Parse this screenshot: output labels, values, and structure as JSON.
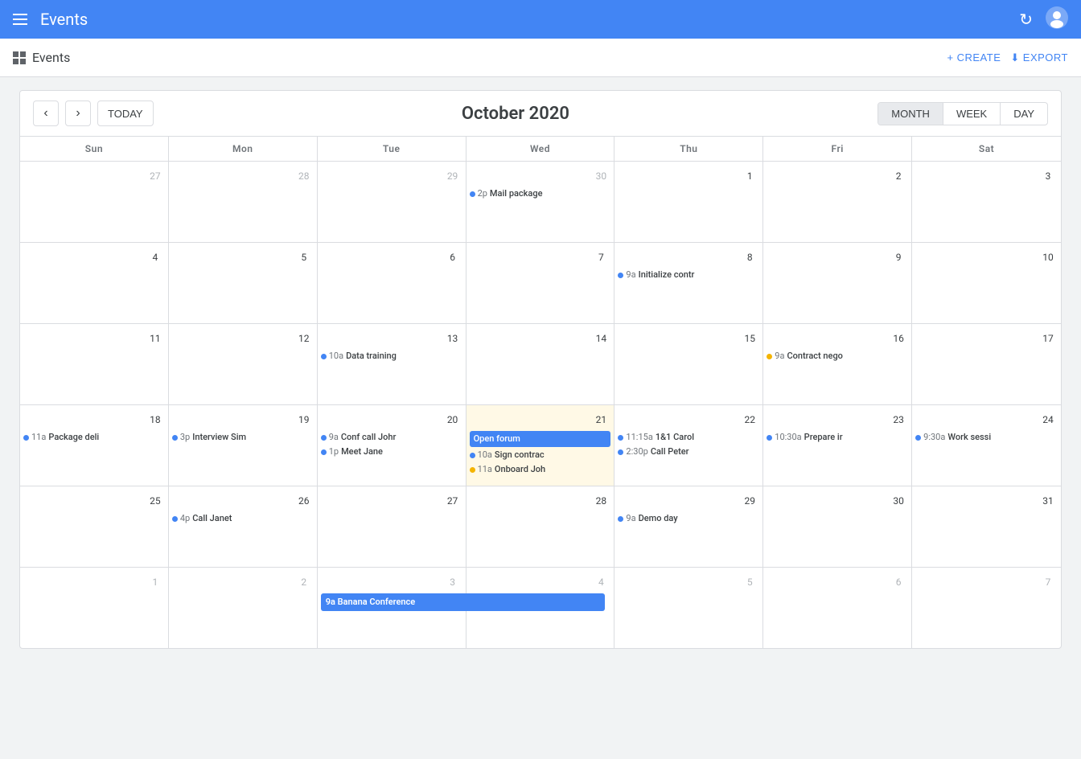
{
  "appBar": {
    "title": "Events",
    "refreshIcon": "↻",
    "profileIcon": "👤"
  },
  "toolbar": {
    "gridIconLabel": "grid-icon",
    "pageTitle": "Events",
    "createLabel": "CREATE",
    "exportLabel": "EXPORT",
    "createIcon": "+",
    "exportIcon": "⬇"
  },
  "calendar": {
    "prevLabel": "‹",
    "nextLabel": "›",
    "todayLabel": "TODAY",
    "monthYear": "October 2020",
    "views": [
      {
        "id": "month",
        "label": "MONTH",
        "active": true
      },
      {
        "id": "week",
        "label": "WEEK",
        "active": false
      },
      {
        "id": "day",
        "label": "DAY",
        "active": false
      }
    ],
    "dayHeaders": [
      "Sun",
      "Mon",
      "Tue",
      "Wed",
      "Thu",
      "Fri",
      "Sat"
    ],
    "weeks": [
      {
        "days": [
          {
            "num": 27,
            "otherMonth": true,
            "events": []
          },
          {
            "num": 28,
            "otherMonth": true,
            "events": []
          },
          {
            "num": 29,
            "otherMonth": true,
            "events": []
          },
          {
            "num": 30,
            "otherMonth": true,
            "events": [
              {
                "type": "dot",
                "dotColor": "blue",
                "time": "2p",
                "name": "Mail package"
              }
            ]
          },
          {
            "num": 1,
            "today": false,
            "events": []
          },
          {
            "num": 2,
            "events": []
          },
          {
            "num": 3,
            "events": []
          }
        ]
      },
      {
        "days": [
          {
            "num": 4,
            "events": []
          },
          {
            "num": 5,
            "events": []
          },
          {
            "num": 6,
            "events": []
          },
          {
            "num": 7,
            "events": []
          },
          {
            "num": 8,
            "events": [
              {
                "type": "dot",
                "dotColor": "blue",
                "time": "9a",
                "name": "Initialize contr"
              }
            ]
          },
          {
            "num": 9,
            "events": []
          },
          {
            "num": 10,
            "events": []
          }
        ]
      },
      {
        "days": [
          {
            "num": 11,
            "events": []
          },
          {
            "num": 12,
            "events": []
          },
          {
            "num": 13,
            "events": [
              {
                "type": "dot",
                "dotColor": "blue",
                "time": "10a",
                "name": "Data training"
              }
            ]
          },
          {
            "num": 14,
            "events": []
          },
          {
            "num": 15,
            "events": []
          },
          {
            "num": 16,
            "events": [
              {
                "type": "dot",
                "dotColor": "yellow",
                "time": "9a",
                "name": "Contract nego"
              }
            ]
          },
          {
            "num": 17,
            "events": []
          }
        ]
      },
      {
        "days": [
          {
            "num": 18,
            "events": [
              {
                "type": "dot",
                "dotColor": "blue",
                "time": "11a",
                "name": "Package deli"
              }
            ]
          },
          {
            "num": 19,
            "events": [
              {
                "type": "dot",
                "dotColor": "blue",
                "time": "3p",
                "name": "Interview Sim"
              }
            ]
          },
          {
            "num": 20,
            "events": [
              {
                "type": "dot",
                "dotColor": "blue",
                "time": "9a",
                "name": "Conf call Johr"
              },
              {
                "type": "dot",
                "dotColor": "blue",
                "time": "1p",
                "name": "Meet Jane"
              }
            ]
          },
          {
            "num": 21,
            "highlighted": true,
            "events": [
              {
                "type": "block",
                "name": "Open forum"
              },
              {
                "type": "dot",
                "dotColor": "blue",
                "time": "10a",
                "name": "Sign contrac"
              },
              {
                "type": "dot",
                "dotColor": "yellow",
                "time": "11a",
                "name": "Onboard Joh"
              }
            ]
          },
          {
            "num": 22,
            "events": [
              {
                "type": "dot",
                "dotColor": "blue",
                "time": "11:15a",
                "name": "1&1 Carol"
              },
              {
                "type": "dot",
                "dotColor": "blue",
                "time": "2:30p",
                "name": "Call Peter"
              }
            ]
          },
          {
            "num": 23,
            "events": [
              {
                "type": "dot",
                "dotColor": "blue",
                "time": "10:30a",
                "name": "Prepare ir"
              }
            ]
          },
          {
            "num": 24,
            "events": [
              {
                "type": "dot",
                "dotColor": "blue",
                "time": "9:30a",
                "name": "Work sessi"
              }
            ]
          }
        ]
      },
      {
        "days": [
          {
            "num": 25,
            "events": []
          },
          {
            "num": 26,
            "events": [
              {
                "type": "dot",
                "dotColor": "blue",
                "time": "4p",
                "name": "Call Janet"
              }
            ]
          },
          {
            "num": 27,
            "events": []
          },
          {
            "num": 28,
            "events": []
          },
          {
            "num": 29,
            "events": [
              {
                "type": "dot",
                "dotColor": "blue",
                "time": "9a",
                "name": "Demo day"
              }
            ]
          },
          {
            "num": 30,
            "events": []
          },
          {
            "num": 31,
            "events": []
          }
        ]
      },
      {
        "days": [
          {
            "num": 1,
            "otherMonth": true,
            "events": []
          },
          {
            "num": 2,
            "otherMonth": true,
            "events": []
          },
          {
            "num": 3,
            "otherMonth": true,
            "events": [
              {
                "type": "block-wide",
                "time": "9a",
                "name": "Banana Conference",
                "spanEnd": 4
              }
            ]
          },
          {
            "num": 4,
            "otherMonth": true,
            "events": []
          },
          {
            "num": 5,
            "otherMonth": true,
            "events": []
          },
          {
            "num": 6,
            "otherMonth": true,
            "events": []
          },
          {
            "num": 7,
            "otherMonth": true,
            "events": []
          }
        ]
      }
    ]
  }
}
